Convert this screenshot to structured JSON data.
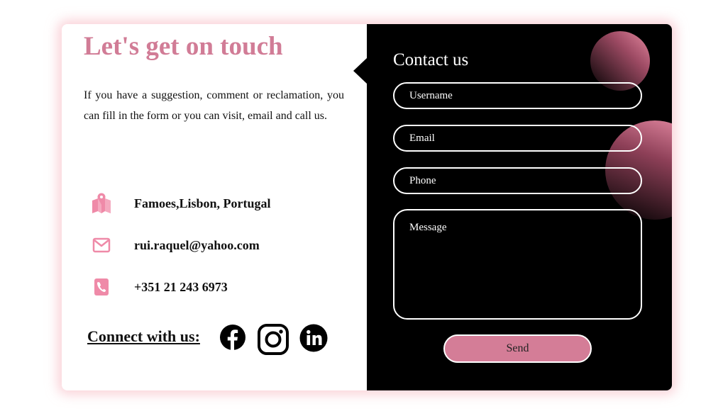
{
  "left": {
    "title": "Let's get on touch",
    "intro": "If you have a suggestion, comment or reclamation, you can fill in the form or you can visit, email and call us.",
    "info": [
      {
        "icon": "map-pin-icon",
        "text": "Famoes,Lisbon, Portugal"
      },
      {
        "icon": "envelope-icon",
        "text": "rui.raquel@yahoo.com"
      },
      {
        "icon": "phone-icon",
        "text": "+351 21 243 6973"
      }
    ],
    "connect_label": "Connect with us:",
    "social": [
      "facebook-icon",
      "instagram-icon",
      "linkedin-icon"
    ]
  },
  "right": {
    "title": "Contact us",
    "username_placeholder": "Username",
    "email_placeholder": "Email",
    "phone_placeholder": "Phone",
    "message_placeholder": "Message",
    "send_label": "Send"
  },
  "colors": {
    "accent": "#d17c96",
    "icon_pink": "#ef8aa8",
    "panel": "#000000",
    "button": "#d47d97"
  }
}
